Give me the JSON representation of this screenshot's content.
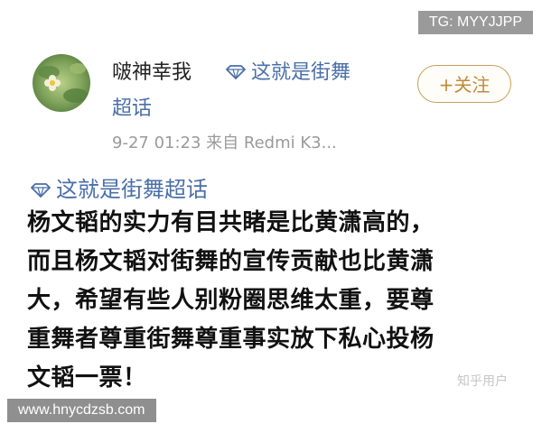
{
  "watermarks": {
    "top_right": "TG: MYYJJPP",
    "bottom_left": "www.hnycdzsb.com",
    "zhihu": "知乎用户"
  },
  "post": {
    "username": "啵神幸我",
    "topic_part1": "这就是街舞",
    "topic_part2": "超话",
    "follow_label": "+关注",
    "meta": "9-27 01:23  来自 Redmi K3...",
    "topic_full": "这就是街舞超话",
    "body_lines": [
      "杨文韬的实力有目共睹是比黄潇高的，",
      "而且杨文韬对街舞的宣传贡献也比黄潇",
      "大，希望有些人别粉圈思维太重，要尊",
      "重舞者尊重街舞尊重事实放下私心投杨",
      "文韬一票！"
    ]
  },
  "colors": {
    "topic_link": "#4a6fa8",
    "follow_accent": "#c08a3a",
    "meta_gray": "#9a9a9a"
  },
  "icons": [
    "avatar-flower-image",
    "super-topic-diamond-icon"
  ]
}
